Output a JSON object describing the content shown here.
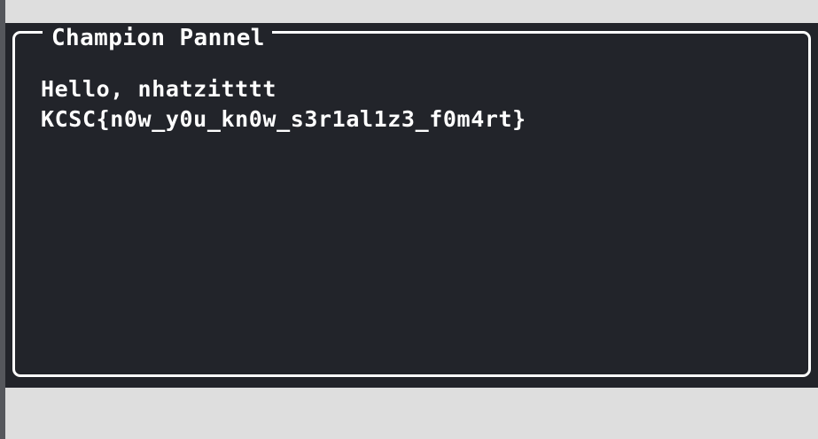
{
  "panel": {
    "title": "Champion Pannel",
    "greeting": "Hello, nhatzitttt",
    "flag": "KCSC{n0w_y0u_kn0w_s3r1al1z3_f0m4rt}"
  },
  "colors": {
    "page_background": "#dedede",
    "panel_background": "#22242a",
    "text": "#ffffff",
    "left_edge": "#55575c"
  }
}
